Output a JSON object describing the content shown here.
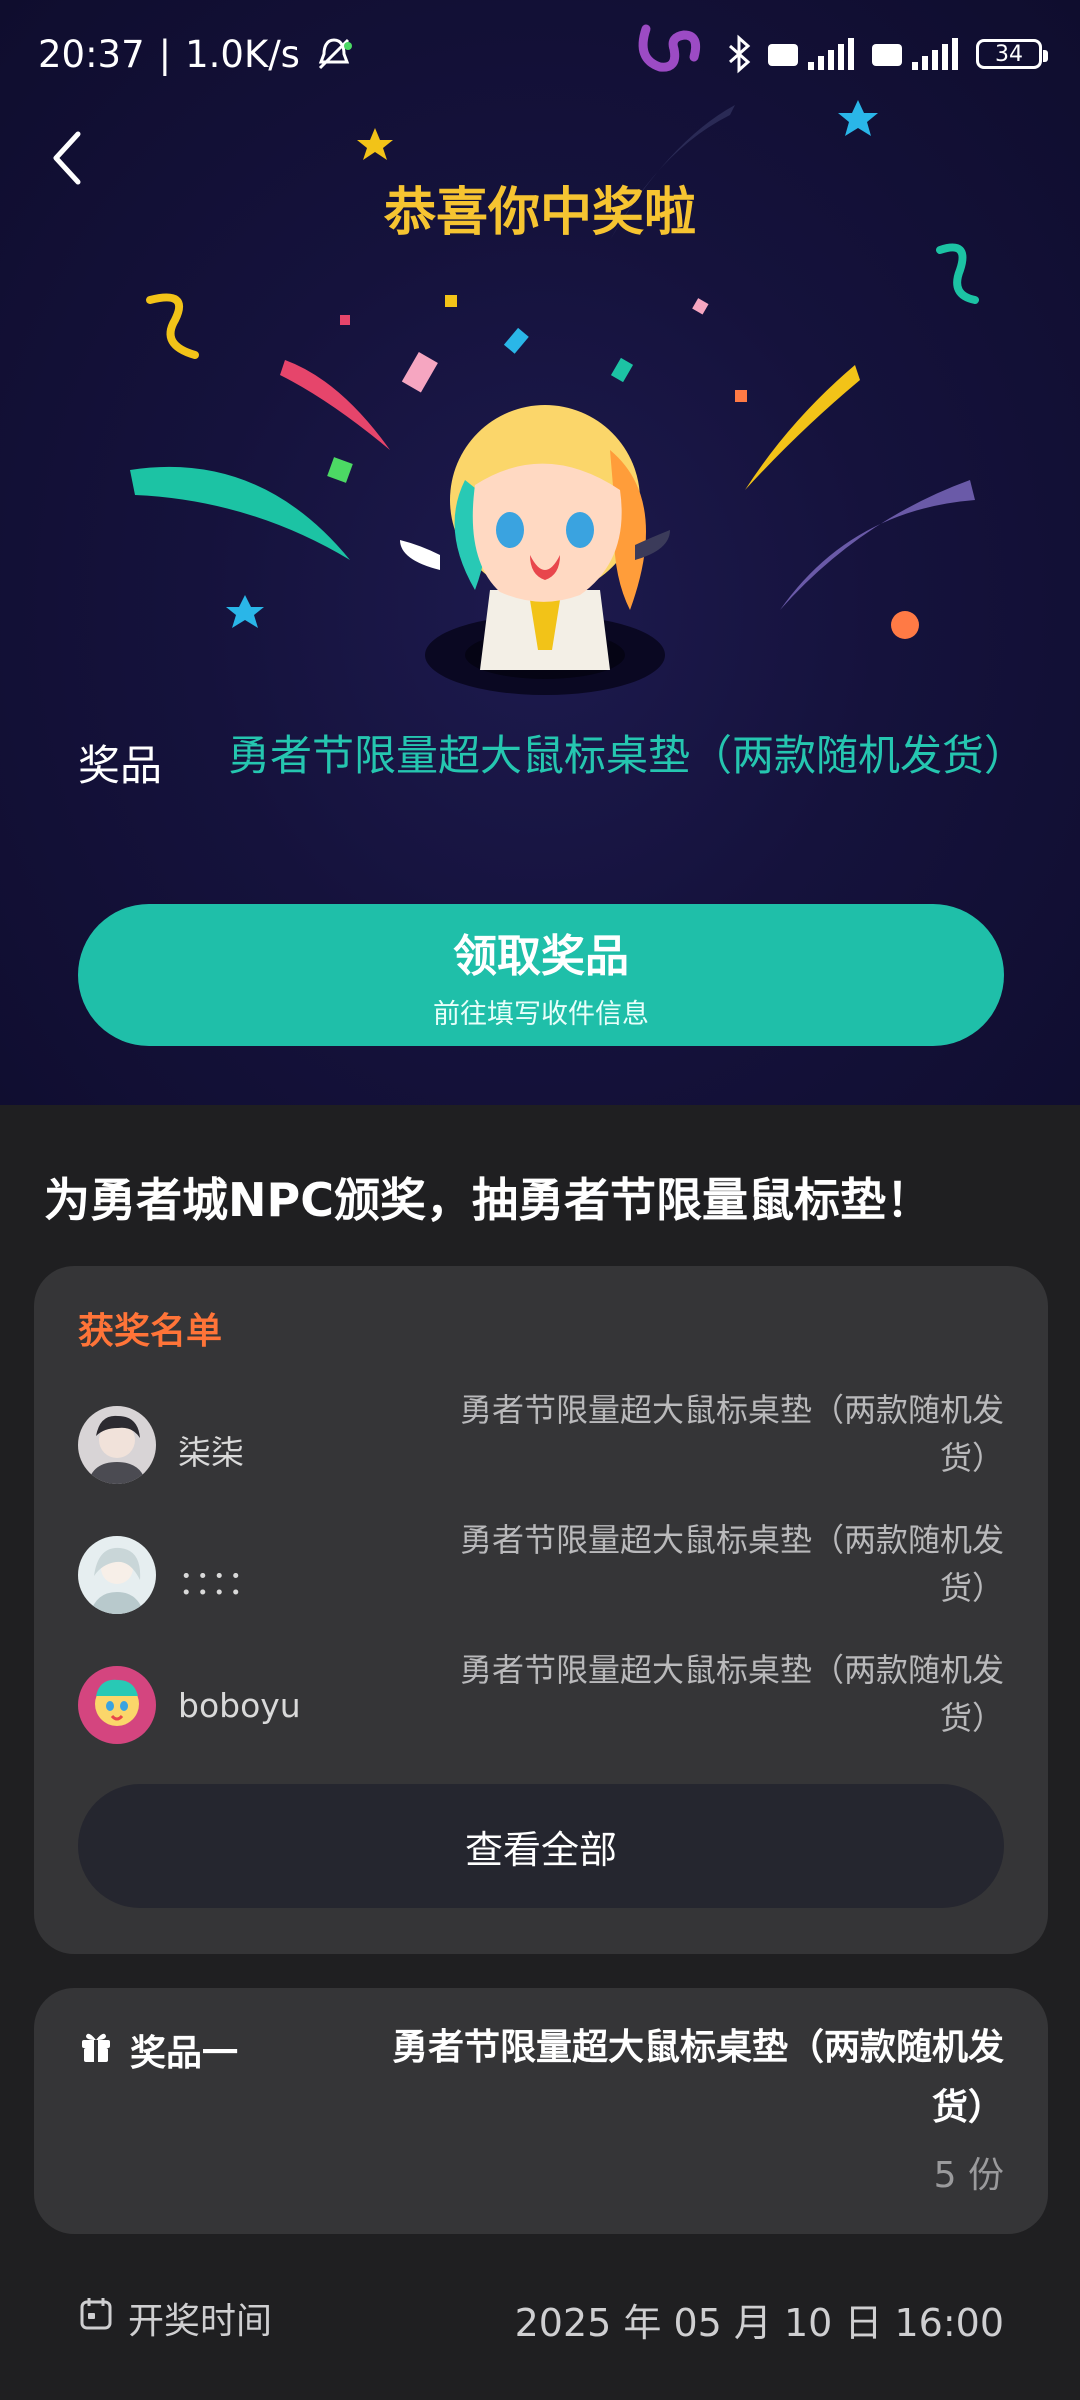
{
  "status_bar": {
    "time": "20:37",
    "speed": "1.0K/s",
    "battery": "34"
  },
  "header": {
    "title": "恭喜你中奖啦"
  },
  "prize": {
    "label": "奖品",
    "value": "勇者节限量超大鼠标桌垫（两款随机发货）"
  },
  "claim_button": {
    "title": "领取奖品",
    "subtitle": "前往填写收件信息"
  },
  "event": {
    "title": "为勇者城NPC颁奖，抽勇者节限量鼠标垫！"
  },
  "winners": {
    "heading": "获奖名单",
    "list": [
      {
        "name": "柒柒",
        "prize": "勇者节限量超大鼠标桌垫（两款随机发货）"
      },
      {
        "name": "：：：：",
        "prize": "勇者节限量超大鼠标桌垫（两款随机发货）"
      },
      {
        "name": "boboyu",
        "prize": "勇者节限量超大鼠标桌垫（两款随机发货）"
      }
    ],
    "view_all": "查看全部"
  },
  "prize_card": {
    "label": "奖品一",
    "value": "勇者节限量超大鼠标桌垫（两款随机发货）",
    "count": "5 份"
  },
  "draw_time": {
    "label": "开奖时间",
    "value": "2025 年 05 月 10 日 16:00"
  },
  "colors": {
    "accent": "#1fbfa9",
    "title_gold": "#f6c431",
    "winners_heading": "#ff7438",
    "hero_bg": "#15123c"
  }
}
